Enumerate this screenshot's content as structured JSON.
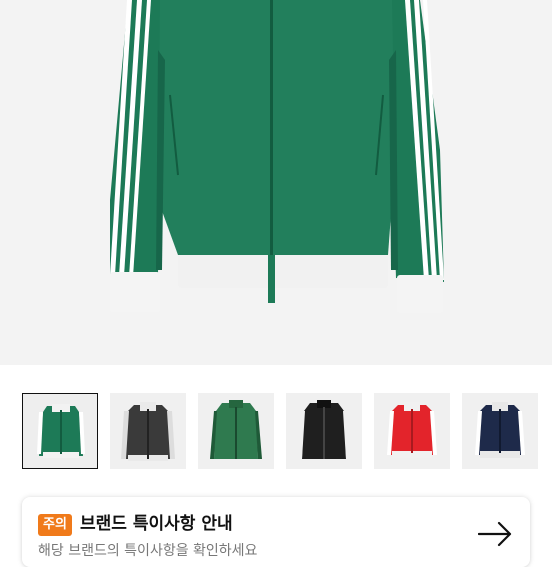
{
  "colors": {
    "accent": "#f07a1a",
    "hero_background": "#f3f3f3",
    "jacket_green": "#1d7a57"
  },
  "thumbnails": [
    {
      "name": "green-white-track-jacket",
      "selected": true
    },
    {
      "name": "dark-grey-track-jacket",
      "selected": false
    },
    {
      "name": "green-track-jacket",
      "selected": false
    },
    {
      "name": "black-track-jacket",
      "selected": false
    },
    {
      "name": "red-track-jacket",
      "selected": false
    },
    {
      "name": "navy-track-jacket",
      "selected": false
    }
  ],
  "notice": {
    "badge": "주의",
    "title": "브랜드 특이사항 안내",
    "subtitle": "해당 브랜드의 특이사항을 확인하세요",
    "arrow_icon": "arrow-right-icon"
  }
}
